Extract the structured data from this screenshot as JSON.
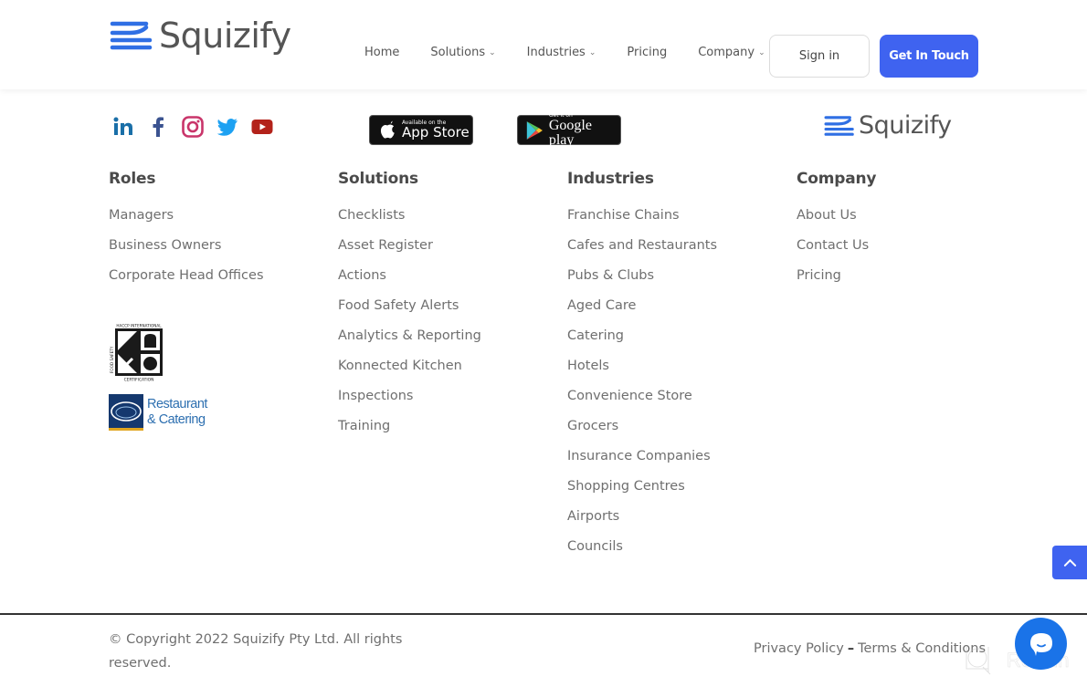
{
  "brand": {
    "name": "Squizify",
    "accent_color": "#3f63f0",
    "logo_blue": "#2f6fe4"
  },
  "header": {
    "nav": [
      {
        "label": "Home",
        "has_dropdown": false
      },
      {
        "label": "Solutions",
        "has_dropdown": true
      },
      {
        "label": "Industries",
        "has_dropdown": true
      },
      {
        "label": "Pricing",
        "has_dropdown": false
      },
      {
        "label": "Company",
        "has_dropdown": true
      }
    ],
    "dropdown_icon": "chevron-down-icon",
    "sign_in_label": "Sign in",
    "cta_label": "Get In Touch"
  },
  "social": [
    {
      "icon": "linkedin-icon",
      "label": "LinkedIn",
      "color": "#1a6fa8"
    },
    {
      "icon": "facebook-icon",
      "label": "Facebook",
      "color": "#3b5390"
    },
    {
      "icon": "instagram-icon",
      "label": "Instagram",
      "color": "#c9356a"
    },
    {
      "icon": "twitter-icon",
      "label": "Twitter",
      "color": "#1da1f2"
    },
    {
      "icon": "youtube-icon",
      "label": "YouTube",
      "color": "#b3221a"
    }
  ],
  "stores": {
    "app_store": {
      "small": "Available on the",
      "big": "App Store"
    },
    "google_play": {
      "small": "Get it on",
      "big": "Google play"
    }
  },
  "footer": {
    "columns": [
      {
        "title": "Roles",
        "items": [
          "Managers",
          "Business Owners",
          "Corporate Head Offices"
        ]
      },
      {
        "title": "Solutions",
        "items": [
          "Checklists",
          "Asset Register",
          "Actions",
          "Food Safety Alerts",
          "Analytics & Reporting",
          "Konnected Kitchen",
          "Inspections",
          "Training"
        ]
      },
      {
        "title": "Industries",
        "items": [
          "Franchise Chains",
          "Cafes and Restaurants",
          "Pubs & Clubs",
          "Aged Care",
          "Catering",
          "Hotels",
          "Convenience Store",
          "Grocers",
          "Insurance Companies",
          "Shopping Centres",
          "Airports",
          "Councils"
        ]
      },
      {
        "title": "Company",
        "items": [
          "About Us",
          "Contact Us",
          "Pricing"
        ]
      }
    ],
    "certifications": {
      "haccp": {
        "top": "HACCP INTERNATIONAL",
        "left": "FOOD SAFETY",
        "bottom": "CERTIFICATION"
      },
      "restaurant_catering": {
        "line1": "Restaurant",
        "line2": "& Catering"
      }
    },
    "copyright": "© Copyright 2022 Squizify Pty Ltd. All rights reserved.",
    "privacy_label": "Privacy Policy",
    "separator": "–",
    "terms_label": "Terms & Conditions"
  },
  "widgets": {
    "scroll_top_icon": "chevron-up-icon",
    "chat_icon": "chat-bubble-icon",
    "watermark_text": "Revain"
  }
}
